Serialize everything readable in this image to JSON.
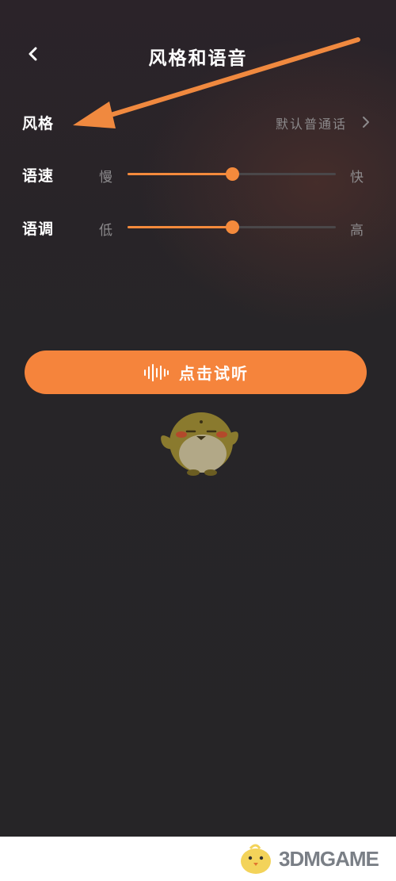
{
  "header": {
    "title": "风格和语音",
    "back_icon": "chevron-left-icon"
  },
  "style_setting": {
    "label": "风格",
    "value": "默认普通话",
    "chevron_icon": "chevron-right-icon"
  },
  "speed_setting": {
    "label": "语速",
    "min_label": "慢",
    "max_label": "快",
    "level": 0.5
  },
  "pitch_setting": {
    "label": "语调",
    "min_label": "低",
    "max_label": "高",
    "level": 0.5
  },
  "listen_button": {
    "label": "点击试听",
    "icon": "sound-wave-icon"
  },
  "mascot": {
    "icon": "chick-mascot-icon"
  },
  "watermark": {
    "text": "3DMGAME"
  },
  "colors": {
    "accent": "#f5843c",
    "background": "#262527",
    "text_primary": "#ffffff",
    "text_secondary": "#8c8a8c",
    "track_inactive": "#4a4749"
  }
}
